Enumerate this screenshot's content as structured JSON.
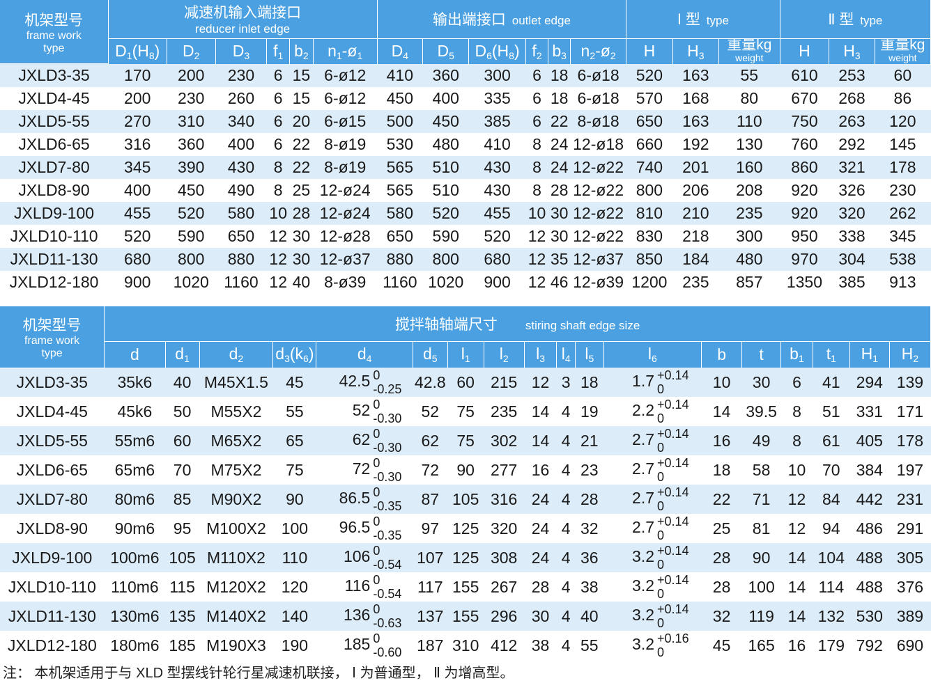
{
  "table1": {
    "groups": {
      "frame": {
        "cn": "机架型号",
        "en1": "frame work",
        "en2": "type"
      },
      "inlet": {
        "cn": "减速机输入端接口",
        "en": "reducer inlet edge"
      },
      "outlet": {
        "cn": "输出端接口",
        "en": "outlet edge"
      },
      "type1": {
        "cn": "Ⅰ 型",
        "en": "type"
      },
      "type2": {
        "cn": "Ⅱ 型",
        "en": "type"
      }
    },
    "columns": [
      {
        "main": "D",
        "sub": "1",
        "tail": "(H",
        "tail_sub": "8",
        "end": ")"
      },
      {
        "main": "D",
        "sub": "2"
      },
      {
        "main": "D",
        "sub": "3"
      },
      {
        "main": "f",
        "sub": "1"
      },
      {
        "main": "b",
        "sub": "2"
      },
      {
        "main": "n",
        "sub": "1",
        "tail": "-ø",
        "tail_sub": "1"
      },
      {
        "main": "D",
        "sub": "4"
      },
      {
        "main": "D",
        "sub": "5"
      },
      {
        "main": "D",
        "sub": "6",
        "tail": "(H",
        "tail_sub": "8",
        "end": ")"
      },
      {
        "main": "f",
        "sub": "2"
      },
      {
        "main": "b",
        "sub": "3"
      },
      {
        "main": "n",
        "sub": "2",
        "tail": "-ø",
        "tail_sub": "2"
      },
      {
        "main": "H"
      },
      {
        "main": "H",
        "sub": "3"
      },
      {
        "weight_cn": "重量kg",
        "weight_en": "weight"
      },
      {
        "main": "H"
      },
      {
        "main": "H",
        "sub": "3"
      },
      {
        "weight_cn": "重量kg",
        "weight_en": "weight"
      }
    ],
    "rows": [
      [
        "JXLD3-35",
        "170",
        "200",
        "230",
        "6",
        "15",
        "6-ø12",
        "410",
        "360",
        "300",
        "6",
        "18",
        "6-ø18",
        "520",
        "163",
        "55",
        "610",
        "253",
        "60"
      ],
      [
        "JXLD4-45",
        "200",
        "230",
        "260",
        "6",
        "15",
        "6-ø12",
        "450",
        "400",
        "335",
        "6",
        "18",
        "6-ø18",
        "570",
        "168",
        "80",
        "670",
        "268",
        "86"
      ],
      [
        "JXLD5-55",
        "270",
        "310",
        "340",
        "6",
        "20",
        "6-ø15",
        "500",
        "450",
        "385",
        "6",
        "22",
        "8-ø18",
        "650",
        "163",
        "110",
        "750",
        "263",
        "120"
      ],
      [
        "JXLD6-65",
        "316",
        "360",
        "400",
        "6",
        "22",
        "8-ø19",
        "530",
        "480",
        "410",
        "8",
        "24",
        "12-ø18",
        "660",
        "192",
        "130",
        "760",
        "292",
        "145"
      ],
      [
        "JXLD7-80",
        "345",
        "390",
        "430",
        "8",
        "22",
        "8-ø19",
        "565",
        "510",
        "430",
        "8",
        "24",
        "12-ø22",
        "740",
        "201",
        "160",
        "860",
        "321",
        "178"
      ],
      [
        "JXLD8-90",
        "400",
        "450",
        "490",
        "8",
        "25",
        "12-ø24",
        "565",
        "510",
        "430",
        "8",
        "28",
        "12-ø22",
        "800",
        "206",
        "208",
        "920",
        "326",
        "230"
      ],
      [
        "JXLD9-100",
        "455",
        "520",
        "580",
        "10",
        "28",
        "12-ø24",
        "580",
        "520",
        "455",
        "10",
        "30",
        "12-ø22",
        "810",
        "210",
        "235",
        "920",
        "320",
        "262"
      ],
      [
        "JXLD10-110",
        "520",
        "590",
        "650",
        "12",
        "30",
        "12-ø28",
        "650",
        "590",
        "520",
        "12",
        "30",
        "12-ø22",
        "830",
        "218",
        "300",
        "950",
        "338",
        "345"
      ],
      [
        "JXLD11-130",
        "680",
        "800",
        "880",
        "12",
        "30",
        "12-ø37",
        "880",
        "800",
        "680",
        "12",
        "35",
        "12-ø37",
        "850",
        "184",
        "480",
        "970",
        "304",
        "538"
      ],
      [
        "JXLD12-180",
        "900",
        "1020",
        "1160",
        "12",
        "40",
        "8-ø39",
        "1160",
        "1020",
        "900",
        "12",
        "46",
        "12-ø39",
        "1200",
        "235",
        "857",
        "1350",
        "385",
        "913"
      ]
    ]
  },
  "table2": {
    "groups": {
      "frame": {
        "cn": "机架型号",
        "en1": "frame work",
        "en2": "type"
      },
      "shaft": {
        "cn": "搅拌轴轴端尺寸",
        "en": "stiring shaft edge size"
      }
    },
    "columns": [
      {
        "main": "d"
      },
      {
        "main": "d",
        "sub": "1"
      },
      {
        "main": "d",
        "sub": "2"
      },
      {
        "main": "d",
        "sub": "3",
        "tail": "(k",
        "tail_sub": "6",
        "end": ")"
      },
      {
        "main": "d",
        "sub": "4"
      },
      {
        "main": "d",
        "sub": "5"
      },
      {
        "main": "l",
        "sub": "1"
      },
      {
        "main": "l",
        "sub": "2"
      },
      {
        "main": "l",
        "sub": "3"
      },
      {
        "main": "l",
        "sub": "4"
      },
      {
        "main": "l",
        "sub": "5"
      },
      {
        "main": "l",
        "sub": "6"
      },
      {
        "main": "b"
      },
      {
        "main": "t"
      },
      {
        "main": "b",
        "sub": "1"
      },
      {
        "main": "t",
        "sub": "1"
      },
      {
        "main": "H",
        "sub": "1"
      },
      {
        "main": "H",
        "sub": "2"
      }
    ],
    "rows": [
      {
        "model": "JXLD3-35",
        "d": "35k6",
        "d1": "40",
        "d2": "M45X1.5",
        "d3": "45",
        "d4": "42.5",
        "d4_up": "0",
        "d4_lo": "-0.25",
        "d5": "42.8",
        "l1": "60",
        "l2": "215",
        "l3": "12",
        "l4": "3",
        "l5": "18",
        "l6": "1.7",
        "l6_up": "+0.14",
        "l6_lo": "0",
        "b": "10",
        "t": "30",
        "b1": "6",
        "t1": "41",
        "H1": "294",
        "H2": "139"
      },
      {
        "model": "JXLD4-45",
        "d": "45k6",
        "d1": "50",
        "d2": "M55X2",
        "d3": "55",
        "d4": "52",
        "d4_up": "0",
        "d4_lo": "-0.30",
        "d5": "52",
        "l1": "75",
        "l2": "235",
        "l3": "14",
        "l4": "4",
        "l5": "19",
        "l6": "2.2",
        "l6_up": "+0.14",
        "l6_lo": "0",
        "b": "14",
        "t": "39.5",
        "b1": "8",
        "t1": "51",
        "H1": "331",
        "H2": "171"
      },
      {
        "model": "JXLD5-55",
        "d": "55m6",
        "d1": "60",
        "d2": "M65X2",
        "d3": "65",
        "d4": "62",
        "d4_up": "0",
        "d4_lo": "-0.30",
        "d5": "62",
        "l1": "75",
        "l2": "302",
        "l3": "14",
        "l4": "4",
        "l5": "21",
        "l6": "2.7",
        "l6_up": "+0.14",
        "l6_lo": "0",
        "b": "16",
        "t": "49",
        "b1": "8",
        "t1": "61",
        "H1": "405",
        "H2": "178"
      },
      {
        "model": "JXLD6-65",
        "d": "65m6",
        "d1": "70",
        "d2": "M75X2",
        "d3": "75",
        "d4": "72",
        "d4_up": "0",
        "d4_lo": "-0.30",
        "d5": "72",
        "l1": "90",
        "l2": "277",
        "l3": "16",
        "l4": "4",
        "l5": "23",
        "l6": "2.7",
        "l6_up": "+0.14",
        "l6_lo": "0",
        "b": "18",
        "t": "58",
        "b1": "10",
        "t1": "70",
        "H1": "384",
        "H2": "197"
      },
      {
        "model": "JXLD7-80",
        "d": "80m6",
        "d1": "85",
        "d2": "M90X2",
        "d3": "90",
        "d4": "86.5",
        "d4_up": "0",
        "d4_lo": "-0.35",
        "d5": "87",
        "l1": "105",
        "l2": "316",
        "l3": "24",
        "l4": "4",
        "l5": "28",
        "l6": "2.7",
        "l6_up": "+0.14",
        "l6_lo": "0",
        "b": "22",
        "t": "71",
        "b1": "12",
        "t1": "84",
        "H1": "442",
        "H2": "231"
      },
      {
        "model": "JXLD8-90",
        "d": "90m6",
        "d1": "95",
        "d2": "M100X2",
        "d3": "100",
        "d4": "96.5",
        "d4_up": "0",
        "d4_lo": "-0.35",
        "d5": "97",
        "l1": "125",
        "l2": "320",
        "l3": "24",
        "l4": "4",
        "l5": "32",
        "l6": "2.7",
        "l6_up": "+0.14",
        "l6_lo": "0",
        "b": "25",
        "t": "81",
        "b1": "12",
        "t1": "94",
        "H1": "486",
        "H2": "291"
      },
      {
        "model": "JXLD9-100",
        "d": "100m6",
        "d1": "105",
        "d2": "M110X2",
        "d3": "110",
        "d4": "106",
        "d4_up": "0",
        "d4_lo": "-0.54",
        "d5": "107",
        "l1": "125",
        "l2": "308",
        "l3": "24",
        "l4": "4",
        "l5": "36",
        "l6": "3.2",
        "l6_up": "+0.14",
        "l6_lo": "0",
        "b": "28",
        "t": "90",
        "b1": "14",
        "t1": "104",
        "H1": "488",
        "H2": "305"
      },
      {
        "model": "JXLD10-110",
        "d": "110m6",
        "d1": "115",
        "d2": "M120X2",
        "d3": "120",
        "d4": "116",
        "d4_up": "0",
        "d4_lo": "-0.54",
        "d5": "117",
        "l1": "155",
        "l2": "267",
        "l3": "28",
        "l4": "4",
        "l5": "38",
        "l6": "3.2",
        "l6_up": "+0.14",
        "l6_lo": "0",
        "b": "28",
        "t": "100",
        "b1": "14",
        "t1": "114",
        "H1": "488",
        "H2": "376"
      },
      {
        "model": "JXLD11-130",
        "d": "130m6",
        "d1": "135",
        "d2": "M140X2",
        "d3": "140",
        "d4": "136",
        "d4_up": "0",
        "d4_lo": "-0.63",
        "d5": "137",
        "l1": "155",
        "l2": "296",
        "l3": "30",
        "l4": "4",
        "l5": "40",
        "l6": "3.2",
        "l6_up": "+0.14",
        "l6_lo": "0",
        "b": "32",
        "t": "119",
        "b1": "14",
        "t1": "132",
        "H1": "530",
        "H2": "389"
      },
      {
        "model": "JXLD12-180",
        "d": "180m6",
        "d1": "185",
        "d2": "M190X3",
        "d3": "190",
        "d4": "185",
        "d4_up": "0",
        "d4_lo": "-0.60",
        "d5": "187",
        "l1": "310",
        "l2": "412",
        "l3": "38",
        "l4": "4",
        "l5": "55",
        "l6": "3.2",
        "l6_up": "+0.16",
        "l6_lo": "0",
        "b": "45",
        "t": "165",
        "b1": "16",
        "t1": "179",
        "H1": "792",
        "H2": "690"
      }
    ]
  },
  "note": "注：  本机架适用于与 XLD 型摆线针轮行星减速机联接，  Ⅰ 为普通型，  Ⅱ 为增高型。"
}
